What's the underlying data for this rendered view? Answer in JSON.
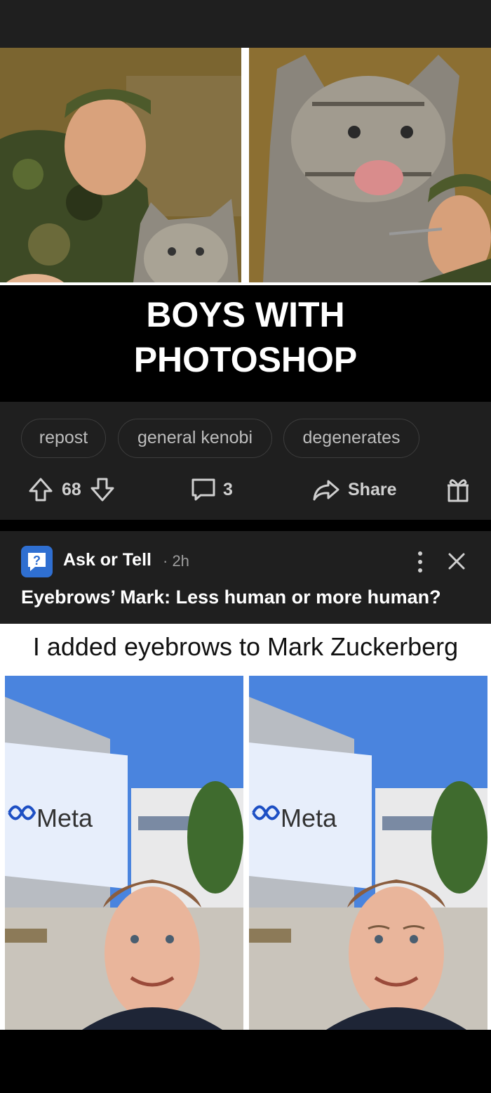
{
  "post1": {
    "image_caption_line1": "BOYS WITH",
    "image_caption_line2": "PHOTOSHOP",
    "tags": [
      "repost",
      "general kenobi",
      "degenerates"
    ],
    "votes": "68",
    "comments": "3",
    "share_label": "Share"
  },
  "post2": {
    "community": "Ask or Tell",
    "time": "· 2h",
    "title": "Eyebrows’ Mark: Less human or more human?",
    "image_caption": "I added eyebrows to Mark Zuckerberg",
    "sign_text": "Meta",
    "sign_text_right": "Meta"
  },
  "colors": {
    "card_bg": "#1f1f1f",
    "community_icon": "#2f6fd1",
    "muted_text": "#9d9d9d"
  }
}
